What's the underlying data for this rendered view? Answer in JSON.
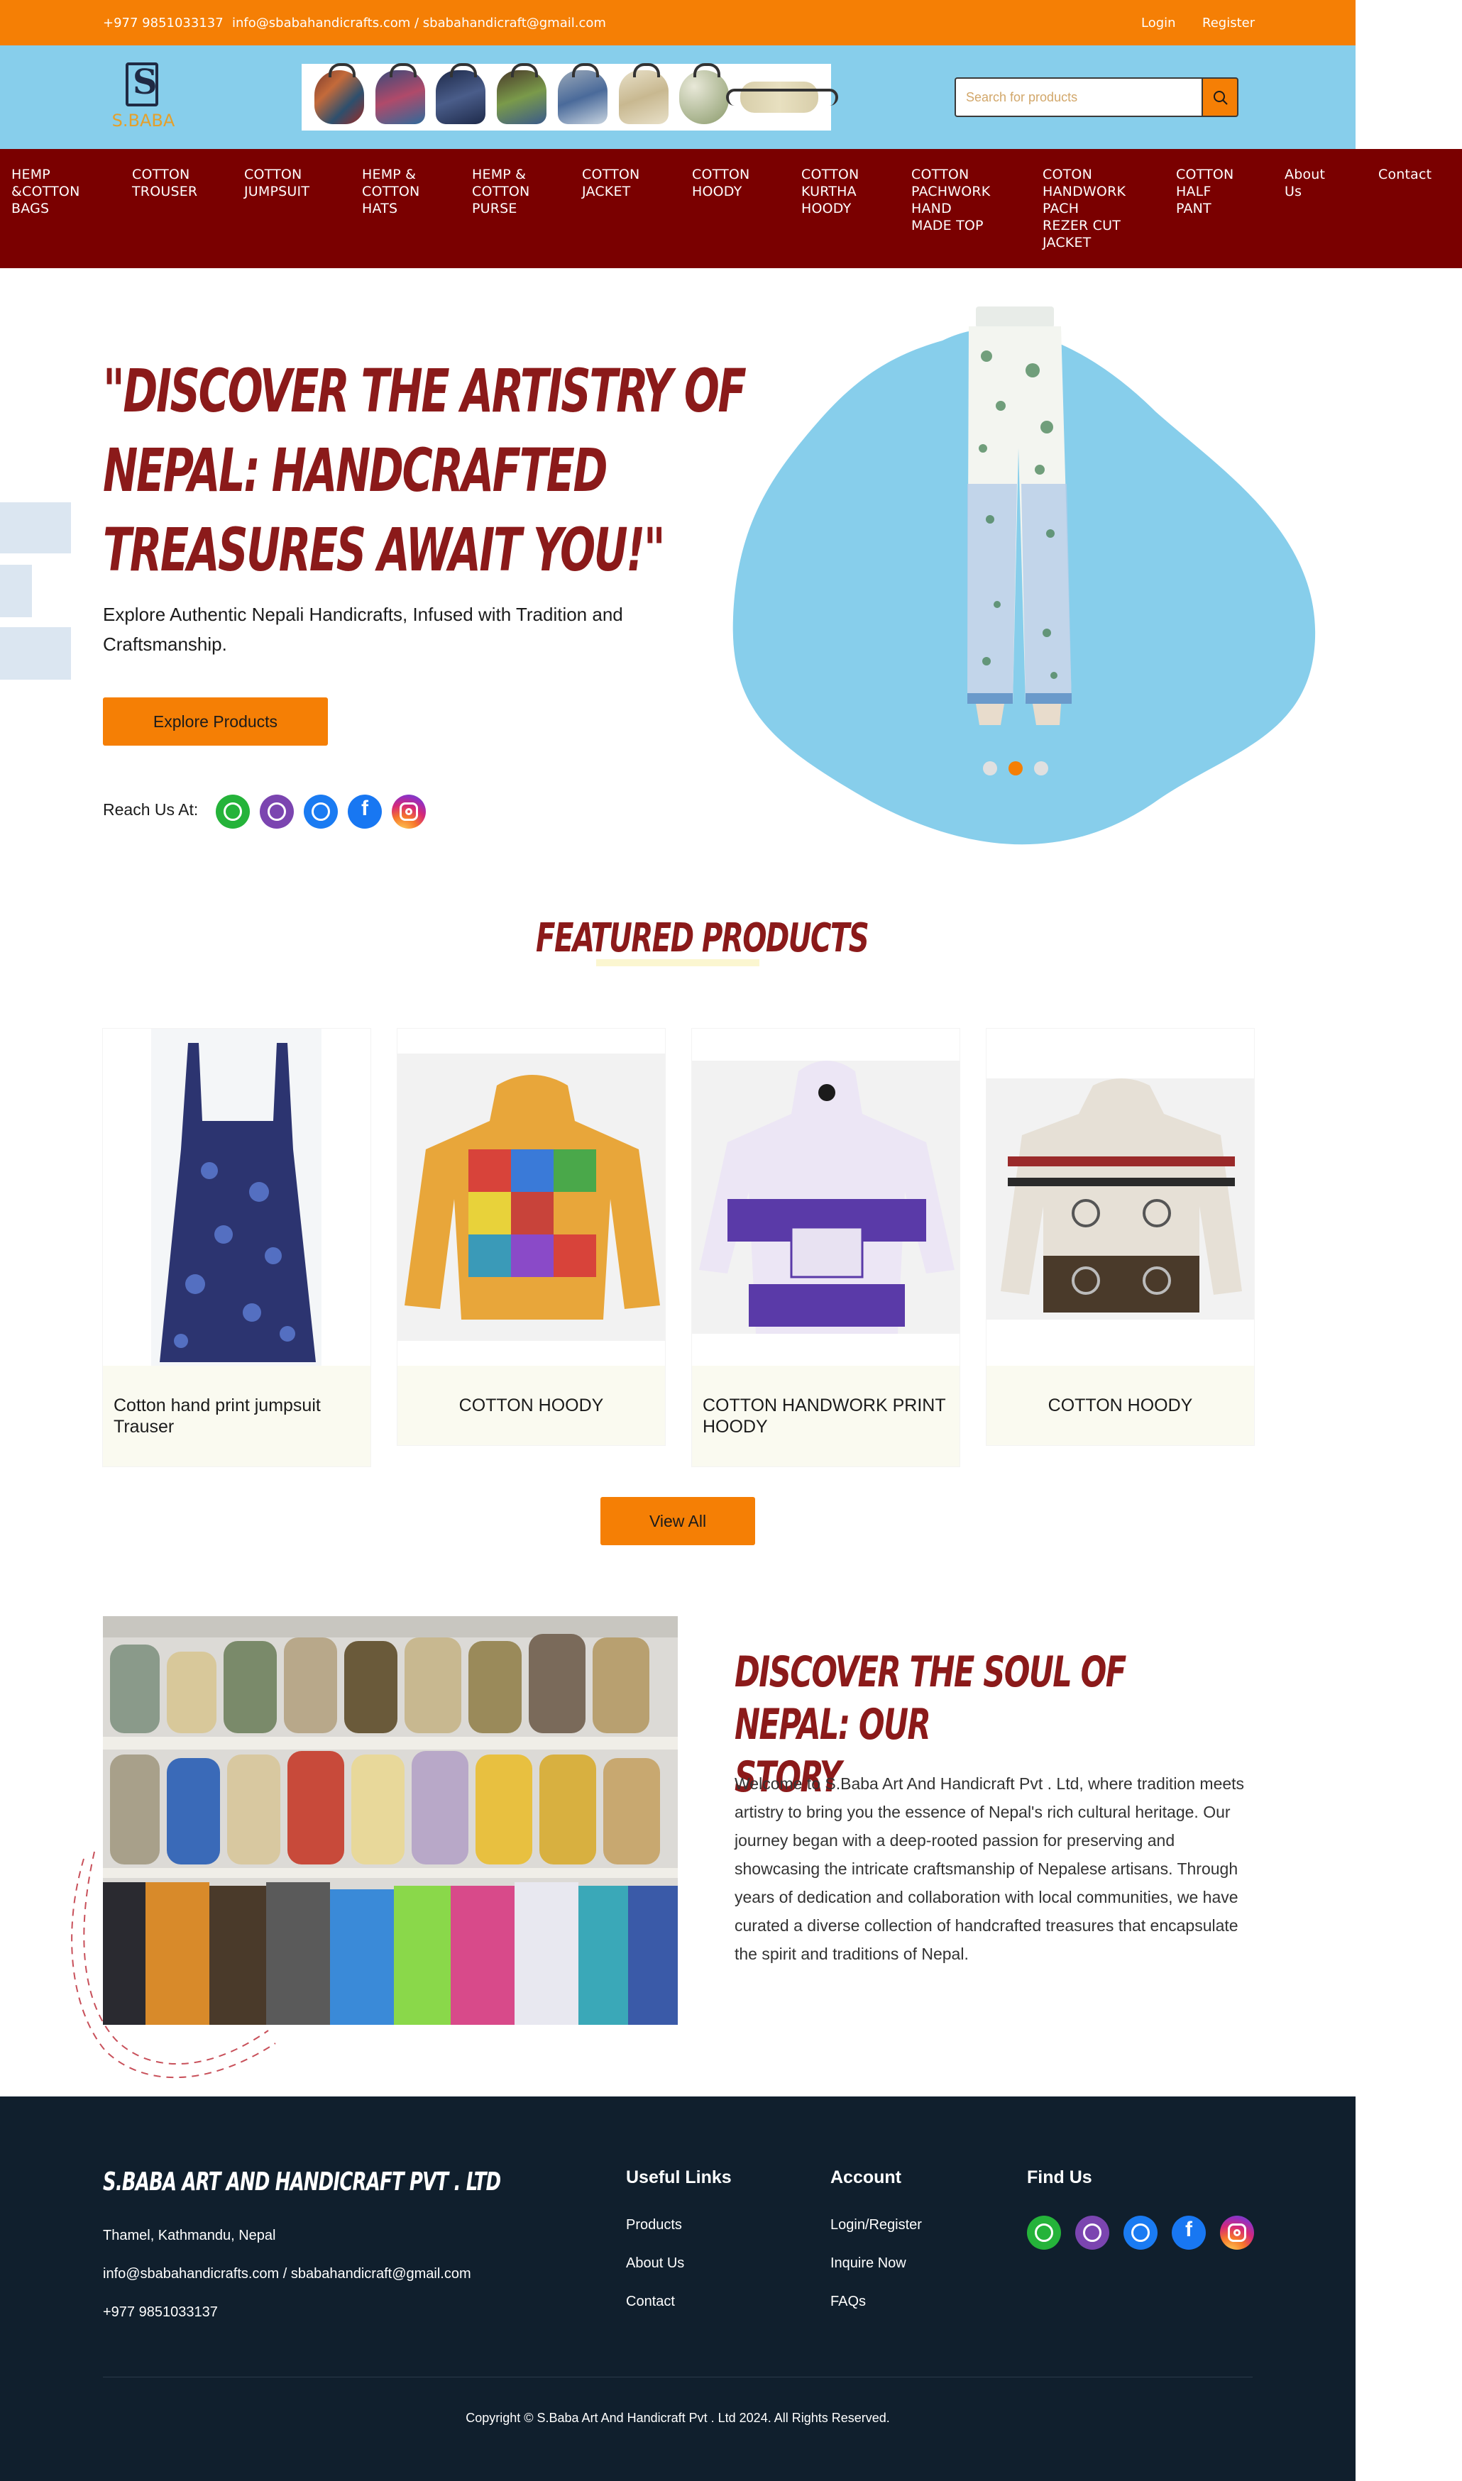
{
  "topbar": {
    "phone": "+977 9851033137",
    "email": "info@sbabahandicrafts.com / sbabahandicraft@gmail.com",
    "login": "Login",
    "register": "Register"
  },
  "header": {
    "logo_text": "S.BABA",
    "search_placeholder": "Search for products"
  },
  "nav": {
    "items": [
      "HEMP\n&COTTON\nBAGS",
      "COTTON\nTROUSER",
      "COTTON\nJUMPSUIT",
      "HEMP &\nCOTTON\nHATS",
      "HEMP &\nCOTTON\nPURSE",
      "COTTON\nJACKET",
      "COTTON\nHOODY",
      "COTTON\nKURTHA\nHOODY",
      "COTTON\nPACHWORK\nHAND\nMADE TOP",
      "COTON\nHANDWORK\nPACH\nREZER CUT\nJACKET",
      "COTTON\nHALF\nPANT",
      "About\nUs",
      "Contact"
    ]
  },
  "hero": {
    "title_lines": [
      "\"DISCOVER THE ARTISTRY OF",
      "NEPAL: HANDCRAFTED",
      "TREASURES AWAIT YOU!\""
    ],
    "subtitle": "Explore Authentic Nepali Handicrafts, Infused with Tradition and Craftsmanship.",
    "button": "Explore Products",
    "reach_label": "Reach Us At:",
    "slide_count": 3,
    "active_slide": 2
  },
  "social": [
    "whatsapp-icon",
    "viber-icon",
    "messenger-icon",
    "facebook-icon",
    "instagram-icon"
  ],
  "featured": {
    "title": "FEATURED PRODUCTS",
    "products": [
      {
        "name": "Cotton hand print jumpsuit Trauser"
      },
      {
        "name": "COTTON HOODY"
      },
      {
        "name": "COTTON HANDWORK PRINT HOODY"
      },
      {
        "name": "COTTON HOODY"
      }
    ],
    "view_all": "View All"
  },
  "story": {
    "title_lines": [
      "DISCOVER THE SOUL OF NEPAL: OUR",
      "STORY"
    ],
    "text": "Welcome to S.Baba Art And Handicraft Pvt . Ltd, where tradition meets artistry to bring you the essence of Nepal's rich cultural heritage. Our journey began with a deep-rooted passion for preserving and showcasing the intricate craftsmanship of Nepalese artisans. Through years of dedication and collaboration with local communities, we have curated a diverse collection of handcrafted treasures that encapsulate the spirit and traditions of Nepal."
  },
  "footer": {
    "brand": "S.BABA ART AND HANDICRAFT PVT . LTD",
    "address": "Thamel, Kathmandu, Nepal",
    "email": "info@sbabahandicrafts.com / sbabahandicraft@gmail.com",
    "phone": "+977 9851033137",
    "useful_links_title": "Useful Links",
    "useful_links": [
      "Products",
      "About Us",
      "Contact"
    ],
    "account_title": "Account",
    "account_links": [
      "Login/Register",
      "Inquire Now",
      "FAQs"
    ],
    "find_us_title": "Find Us",
    "copyright": "Copyright © S.Baba Art And Handicraft Pvt . Ltd 2024. All Rights Reserved."
  },
  "colors": {
    "accent_orange": "#f57f05",
    "header_blue": "#87ceeb",
    "nav_maroon": "#7a0000",
    "title_red": "#8b1a1a",
    "footer_navy": "#101f2d"
  }
}
